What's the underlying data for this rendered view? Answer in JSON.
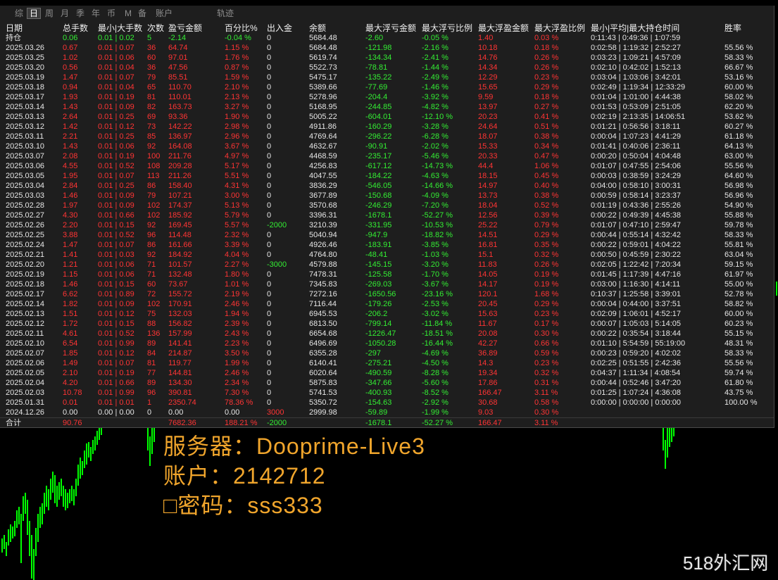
{
  "toolbar": {
    "tabs": [
      {
        "label": "综",
        "active": false
      },
      {
        "label": "日",
        "active": true
      },
      {
        "label": "周",
        "active": false
      },
      {
        "label": "月",
        "active": false
      },
      {
        "label": "季",
        "active": false
      },
      {
        "label": "年",
        "active": false
      },
      {
        "label": "币",
        "active": false
      },
      {
        "label": "M",
        "active": false
      },
      {
        "label": "备",
        "active": false
      },
      {
        "label": "账户",
        "active": false
      },
      {
        "label": "轨迹",
        "active": false
      }
    ]
  },
  "table": {
    "headers": [
      "日期",
      "总手数",
      "最小|大手数",
      "次数",
      "盈亏金额",
      "百分比%",
      "出入金",
      "余额",
      "最大浮亏金额",
      "最大浮亏比例",
      "最大浮盈金额",
      "最大浮盈比例",
      "最小|平均|最大持仓时间",
      "胜率"
    ],
    "rows": [
      {
        "tone": "loss",
        "cells": [
          "持仓",
          "0.06",
          "0.01 | 0.02",
          "5",
          "-2.14",
          "-0.04 %",
          "0",
          "5684.48",
          "-2.60",
          "-0.05 %",
          "1.40",
          "0.03 %",
          "0:11:43 | 0:49:36 | 1:07:59",
          ""
        ]
      },
      {
        "tone": "profit",
        "cells": [
          "2025.03.26",
          "0.67",
          "0.01 | 0.07",
          "36",
          "64.74",
          "1.15 %",
          "0",
          "5684.48",
          "-121.98",
          "-2.16 %",
          "10.18",
          "0.18 %",
          "0:02:58 | 1:19:32 | 2:52:27",
          "55.56 %"
        ]
      },
      {
        "tone": "profit",
        "cells": [
          "2025.03.25",
          "1.02",
          "0.01 | 0.06",
          "60",
          "97.01",
          "1.76 %",
          "0",
          "5619.74",
          "-134.34",
          "-2.41 %",
          "14.76",
          "0.26 %",
          "0:03:23 | 1:09:21 | 4:57:09",
          "58.33 %"
        ]
      },
      {
        "tone": "profit",
        "cells": [
          "2025.03.20",
          "0.56",
          "0.01 | 0.04",
          "36",
          "47.56",
          "0.87 %",
          "0",
          "5522.73",
          "-78.81",
          "-1.44 %",
          "14.34",
          "0.26 %",
          "0:02:10 | 0:42:02 | 1:52:13",
          "66.67 %"
        ]
      },
      {
        "tone": "profit",
        "cells": [
          "2025.03.19",
          "1.47",
          "0.01 | 0.07",
          "79",
          "85.51",
          "1.59 %",
          "0",
          "5475.17",
          "-135.22",
          "-2.49 %",
          "12.29",
          "0.23 %",
          "0:03:04 | 1:03:06 | 3:42:01",
          "53.16 %"
        ]
      },
      {
        "tone": "profit",
        "cells": [
          "2025.03.18",
          "0.94",
          "0.01 | 0.04",
          "65",
          "110.70",
          "2.10 %",
          "0",
          "5389.66",
          "-77.69",
          "-1.46 %",
          "15.65",
          "0.29 %",
          "0:02:49 | 1:19:34 | 12:33:29",
          "60.00 %"
        ]
      },
      {
        "tone": "profit",
        "cells": [
          "2025.03.17",
          "1.93",
          "0.01 | 0.19",
          "81",
          "110.01",
          "2.13 %",
          "0",
          "5278.96",
          "-204.4",
          "-3.92 %",
          "9.59",
          "0.18 %",
          "0:01:04 | 1:01:00 | 4:44:38",
          "58.02 %"
        ]
      },
      {
        "tone": "profit",
        "cells": [
          "2025.03.14",
          "1.43",
          "0.01 | 0.09",
          "82",
          "163.73",
          "3.27 %",
          "0",
          "5168.95",
          "-244.85",
          "-4.82 %",
          "13.97",
          "0.27 %",
          "0:01:53 | 0:53:09 | 2:51:05",
          "62.20 %"
        ]
      },
      {
        "tone": "profit",
        "cells": [
          "2025.03.13",
          "2.64",
          "0.01 | 0.25",
          "69",
          "93.36",
          "1.90 %",
          "0",
          "5005.22",
          "-604.01",
          "-12.10 %",
          "20.23",
          "0.41 %",
          "0:02:19 | 2:13:35 | 14:06:51",
          "53.62 %"
        ]
      },
      {
        "tone": "profit",
        "cells": [
          "2025.03.12",
          "1.42",
          "0.01 | 0.12",
          "73",
          "142.22",
          "2.98 %",
          "0",
          "4911.86",
          "-160.29",
          "-3.28 %",
          "24.64",
          "0.51 %",
          "0:01:21 | 0:56:56 | 3:18:11",
          "60.27 %"
        ]
      },
      {
        "tone": "profit",
        "cells": [
          "2025.03.11",
          "2.21",
          "0.01 | 0.25",
          "85",
          "136.97",
          "2.96 %",
          "0",
          "4769.64",
          "-296.22",
          "-6.28 %",
          "18.07",
          "0.38 %",
          "0:00:04 | 1:07:23 | 4:41:29",
          "61.18 %"
        ]
      },
      {
        "tone": "profit",
        "cells": [
          "2025.03.10",
          "1.43",
          "0.01 | 0.06",
          "92",
          "164.08",
          "3.67 %",
          "0",
          "4632.67",
          "-90.91",
          "-2.02 %",
          "15.33",
          "0.34 %",
          "0:01:41 | 0:40:06 | 2:36:11",
          "64.13 %"
        ]
      },
      {
        "tone": "profit",
        "cells": [
          "2025.03.07",
          "2.08",
          "0.01 | 0.19",
          "100",
          "211.76",
          "4.97 %",
          "0",
          "4468.59",
          "-235.17",
          "-5.46 %",
          "20.33",
          "0.47 %",
          "0:00:20 | 0:50:04 | 4:04:48",
          "63.00 %"
        ]
      },
      {
        "tone": "profit",
        "cells": [
          "2025.03.06",
          "4.55",
          "0.01 | 0.52",
          "108",
          "209.28",
          "5.17 %",
          "0",
          "4256.83",
          "-617.12",
          "-14.73 %",
          "44.4",
          "1.06 %",
          "0:01:07 | 0:47:55 | 2:54:06",
          "55.56 %"
        ]
      },
      {
        "tone": "profit",
        "cells": [
          "2025.03.05",
          "1.95",
          "0.01 | 0.07",
          "113",
          "211.26",
          "5.51 %",
          "0",
          "4047.55",
          "-184.22",
          "-4.63 %",
          "18.15",
          "0.45 %",
          "0:00:03 | 0:38:59 | 3:24:29",
          "64.60 %"
        ]
      },
      {
        "tone": "profit",
        "cells": [
          "2025.03.04",
          "2.84",
          "0.01 | 0.25",
          "86",
          "158.40",
          "4.31 %",
          "0",
          "3836.29",
          "-546.05",
          "-14.66 %",
          "14.97",
          "0.40 %",
          "0:04:00 | 0:58:10 | 3:00:31",
          "56.98 %"
        ]
      },
      {
        "tone": "profit",
        "cells": [
          "2025.03.03",
          "1.46",
          "0.01 | 0.09",
          "79",
          "107.21",
          "3.00 %",
          "0",
          "3677.89",
          "-150.68",
          "-4.09 %",
          "13.73",
          "0.38 %",
          "0:00:59 | 0:58:14 | 3:23:37",
          "56.96 %"
        ]
      },
      {
        "tone": "profit",
        "cells": [
          "2025.02.28",
          "1.97",
          "0.01 | 0.09",
          "102",
          "174.37",
          "5.13 %",
          "0",
          "3570.68",
          "-246.29",
          "-7.20 %",
          "18.04",
          "0.52 %",
          "0:01:19 | 0:43:36 | 2:55:26",
          "54.90 %"
        ]
      },
      {
        "tone": "profit",
        "cells": [
          "2025.02.27",
          "4.30",
          "0.01 | 0.66",
          "102",
          "185.92",
          "5.79 %",
          "0",
          "3396.31",
          "-1678.1",
          "-52.27 %",
          "12.56",
          "0.39 %",
          "0:00:22 | 0:49:39 | 4:45:38",
          "55.88 %"
        ]
      },
      {
        "tone": "profit",
        "cells": [
          "2025.02.26",
          "2.20",
          "0.01 | 0.15",
          "92",
          "169.45",
          "5.57 %",
          "-2000",
          "3210.39",
          "-331.95",
          "-10.53 %",
          "25.22",
          "0.79 %",
          "0:01:07 | 0:47:10 | 2:59:47",
          "59.78 %"
        ]
      },
      {
        "tone": "profit",
        "cells": [
          "2025.02.25",
          "3.88",
          "0.01 | 0.52",
          "96",
          "114.48",
          "2.32 %",
          "0",
          "5040.94",
          "-947.9",
          "-18.82 %",
          "14.51",
          "0.29 %",
          "0:00:44 | 0:55:14 | 4:32:42",
          "58.33 %"
        ]
      },
      {
        "tone": "profit",
        "cells": [
          "2025.02.24",
          "1.47",
          "0.01 | 0.07",
          "86",
          "161.66",
          "3.39 %",
          "0",
          "4926.46",
          "-183.91",
          "-3.85 %",
          "16.81",
          "0.35 %",
          "0:00:22 | 0:59:01 | 4:04:22",
          "55.81 %"
        ]
      },
      {
        "tone": "profit",
        "cells": [
          "2025.02.21",
          "1.41",
          "0.01 | 0.03",
          "92",
          "184.92",
          "4.04 %",
          "0",
          "4764.80",
          "-48.41",
          "-1.03 %",
          "15.1",
          "0.32 %",
          "0:00:50 | 0:45:59 | 2:30:22",
          "63.04 %"
        ]
      },
      {
        "tone": "profit",
        "cells": [
          "2025.02.20",
          "1.21",
          "0.01 | 0.06",
          "71",
          "101.57",
          "2.27 %",
          "-3000",
          "4579.88",
          "-145.15",
          "-3.20 %",
          "11.83",
          "0.26 %",
          "0:02:05 | 1:22:42 | 7:20:34",
          "59.15 %"
        ]
      },
      {
        "tone": "profit",
        "cells": [
          "2025.02.19",
          "1.15",
          "0.01 | 0.06",
          "71",
          "132.48",
          "1.80 %",
          "0",
          "7478.31",
          "-125.58",
          "-1.70 %",
          "14.05",
          "0.19 %",
          "0:01:45 | 1:17:39 | 4:47:16",
          "61.97 %"
        ]
      },
      {
        "tone": "profit",
        "cells": [
          "2025.02.18",
          "1.46",
          "0.01 | 0.15",
          "60",
          "73.67",
          "1.01 %",
          "0",
          "7345.83",
          "-269.03",
          "-3.67 %",
          "14.17",
          "0.19 %",
          "0:03:00 | 1:16:30 | 4:14:11",
          "55.00 %"
        ]
      },
      {
        "tone": "profit",
        "cells": [
          "2025.02.17",
          "6.62",
          "0.01 | 0.89",
          "72",
          "155.72",
          "2.19 %",
          "0",
          "7272.16",
          "-1650.56",
          "-23.16 %",
          "120.1",
          "1.68 %",
          "0:10:37 | 1:25:58 | 3:39:01",
          "52.78 %"
        ]
      },
      {
        "tone": "profit",
        "cells": [
          "2025.02.14",
          "1.82",
          "0.01 | 0.09",
          "102",
          "170.91",
          "2.46 %",
          "0",
          "7116.44",
          "-179.26",
          "-2.53 %",
          "20.45",
          "0.29 %",
          "0:00:04 | 0:44:00 | 3:37:51",
          "58.82 %"
        ]
      },
      {
        "tone": "profit",
        "cells": [
          "2025.02.13",
          "1.51",
          "0.01 | 0.12",
          "75",
          "132.03",
          "1.94 %",
          "0",
          "6945.53",
          "-206.2",
          "-3.02 %",
          "15.63",
          "0.23 %",
          "0:02:09 | 1:06:01 | 4:52:17",
          "60.00 %"
        ]
      },
      {
        "tone": "profit",
        "cells": [
          "2025.02.12",
          "1.72",
          "0.01 | 0.15",
          "88",
          "156.82",
          "2.39 %",
          "0",
          "6813.50",
          "-799.14",
          "-11.84 %",
          "11.67",
          "0.17 %",
          "0:00:07 | 1:05:03 | 5:14:05",
          "60.23 %"
        ]
      },
      {
        "tone": "profit",
        "cells": [
          "2025.02.11",
          "4.61",
          "0.01 | 0.52",
          "136",
          "157.99",
          "2.43 %",
          "0",
          "6654.68",
          "-1226.47",
          "-18.51 %",
          "20.08",
          "0.30 %",
          "0:00:22 | 0:35:54 | 3:18:44",
          "55.15 %"
        ]
      },
      {
        "tone": "profit",
        "cells": [
          "2025.02.10",
          "6.54",
          "0.01 | 0.99",
          "89",
          "141.41",
          "2.23 %",
          "0",
          "6496.69",
          "-1050.28",
          "-16.44 %",
          "42.27",
          "0.66 %",
          "0:01:10 | 5:54:59 | 55:19:00",
          "48.31 %"
        ]
      },
      {
        "tone": "profit",
        "cells": [
          "2025.02.07",
          "1.85",
          "0.01 | 0.12",
          "84",
          "214.87",
          "3.50 %",
          "0",
          "6355.28",
          "-297",
          "-4.69 %",
          "36.89",
          "0.59 %",
          "0:00:23 | 0:59:20 | 4:02:02",
          "58.33 %"
        ]
      },
      {
        "tone": "profit",
        "cells": [
          "2025.02.06",
          "1.49",
          "0.01 | 0.07",
          "81",
          "119.77",
          "1.99 %",
          "0",
          "6140.41",
          "-275.21",
          "-4.50 %",
          "14.3",
          "0.23 %",
          "0:02:25 | 0:51:55 | 2:42:36",
          "55.56 %"
        ]
      },
      {
        "tone": "profit",
        "cells": [
          "2025.02.05",
          "2.10",
          "0.01 | 0.19",
          "77",
          "144.81",
          "2.46 %",
          "0",
          "6020.64",
          "-490.59",
          "-8.28 %",
          "19.34",
          "0.32 %",
          "0:04:37 | 1:11:34 | 4:08:54",
          "59.74 %"
        ]
      },
      {
        "tone": "profit",
        "cells": [
          "2025.02.04",
          "4.20",
          "0.01 | 0.66",
          "89",
          "134.30",
          "2.34 %",
          "0",
          "5875.83",
          "-347.66",
          "-5.60 %",
          "17.86",
          "0.31 %",
          "0:00:44 | 0:52:46 | 3:47:20",
          "61.80 %"
        ]
      },
      {
        "tone": "profit",
        "cells": [
          "2025.02.03",
          "10.78",
          "0.01 | 0.99",
          "96",
          "390.81",
          "7.30 %",
          "0",
          "5741.53",
          "-400.93",
          "-8.52 %",
          "166.47",
          "3.11 %",
          "0:01:25 | 1:07:24 | 4:36:08",
          "43.75 %"
        ]
      },
      {
        "tone": "profit",
        "cells": [
          "2025.01.31",
          "0.01",
          "0.01 | 0.01",
          "1",
          "2350.74",
          "78.36 %",
          "0",
          "5350.72",
          "-154.63",
          "-2.92 %",
          "30.68",
          "0.58 %",
          "0:00:00 | 0:00:00 | 0:00:00",
          "100.00 %"
        ]
      },
      {
        "tone": "neutral",
        "cells": [
          "2024.12.26",
          "0.00",
          "0.00 | 0.00",
          "0",
          "0.00",
          "0.00",
          "3000",
          "2999.98",
          "-59.89",
          "-1.99 %",
          "9.03",
          "0.30 %",
          "",
          ""
        ]
      }
    ],
    "total": {
      "tone": "profit",
      "cells": [
        "合计",
        "90.76",
        "",
        "",
        "7682.36",
        "188.21 %",
        "-2000",
        "",
        "-1678.1",
        "-52.27 %",
        "166.47",
        "3.11 %",
        "",
        ""
      ]
    }
  },
  "colors": {
    "red": "#ff3434",
    "green": "#33ee33",
    "white": "#e6e6e6",
    "overlay": "#f0a52c",
    "candle": "#00ff00"
  },
  "column_colors": [
    "white",
    "tone",
    "tone",
    "tone",
    "tone",
    "tone",
    "sign",
    "white",
    "green",
    "green",
    "red",
    "red",
    "white",
    "white"
  ],
  "overlay": {
    "server": "服务器：Dooprime-Live3",
    "account": "账户：2142712",
    "password": "□密码：sss333"
  },
  "watermark": "518外汇网"
}
